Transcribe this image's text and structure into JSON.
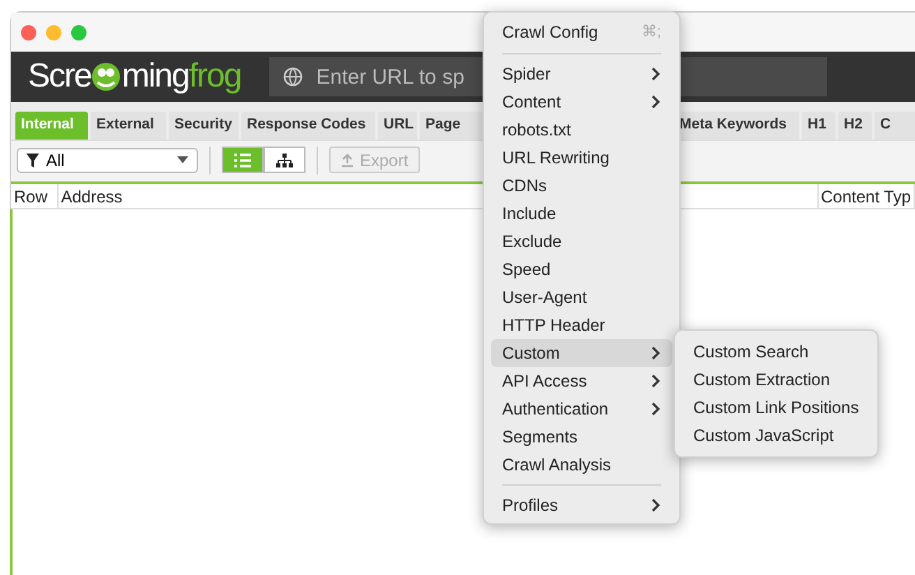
{
  "logo": {
    "prefix": "Scre",
    "middle": "ming",
    "suffix": "frog"
  },
  "url_field": {
    "placeholder": "Enter URL to sp"
  },
  "tabs": [
    {
      "label": "Internal",
      "selected": true
    },
    {
      "label": "External",
      "selected": false
    },
    {
      "label": "Security",
      "selected": false
    },
    {
      "label": "Response Codes",
      "selected": false
    },
    {
      "label": "URL",
      "selected": false
    },
    {
      "label": "Page",
      "selected": false
    },
    {
      "label": "Meta Keywords",
      "selected": false
    },
    {
      "label": "H1",
      "selected": false
    },
    {
      "label": "H2",
      "selected": false
    },
    {
      "label": "C",
      "selected": false
    }
  ],
  "filter": {
    "value": "All"
  },
  "view_toggle": [
    {
      "kind": "list",
      "selected": true
    },
    {
      "kind": "tree",
      "selected": false
    }
  ],
  "export_button": {
    "label": "Export",
    "disabled": true
  },
  "table": {
    "columns": [
      "Row",
      "Address",
      "Content Typ"
    ]
  },
  "menu": {
    "items": [
      {
        "kind": "header",
        "label": "Crawl Config",
        "shortcut": "⌘;"
      },
      {
        "kind": "separator"
      },
      {
        "kind": "item",
        "label": "Spider",
        "submenu": true,
        "selected": false
      },
      {
        "kind": "item",
        "label": "Content",
        "submenu": true,
        "selected": false
      },
      {
        "kind": "item",
        "label": "robots.txt",
        "submenu": false,
        "selected": false
      },
      {
        "kind": "item",
        "label": "URL Rewriting",
        "submenu": false,
        "selected": false
      },
      {
        "kind": "item",
        "label": "CDNs",
        "submenu": false,
        "selected": false
      },
      {
        "kind": "item",
        "label": "Include",
        "submenu": false,
        "selected": false
      },
      {
        "kind": "item",
        "label": "Exclude",
        "submenu": false,
        "selected": false
      },
      {
        "kind": "item",
        "label": "Speed",
        "submenu": false,
        "selected": false
      },
      {
        "kind": "item",
        "label": "User-Agent",
        "submenu": false,
        "selected": false
      },
      {
        "kind": "item",
        "label": "HTTP Header",
        "submenu": false,
        "selected": false
      },
      {
        "kind": "item",
        "label": "Custom",
        "submenu": true,
        "selected": true
      },
      {
        "kind": "item",
        "label": "API Access",
        "submenu": true,
        "selected": false
      },
      {
        "kind": "item",
        "label": "Authentication",
        "submenu": true,
        "selected": false
      },
      {
        "kind": "item",
        "label": "Segments",
        "submenu": false,
        "selected": false
      },
      {
        "kind": "item",
        "label": "Crawl Analysis",
        "submenu": false,
        "selected": false
      },
      {
        "kind": "separator"
      },
      {
        "kind": "item",
        "label": "Profiles",
        "submenu": true,
        "selected": false
      }
    ]
  },
  "submenu": {
    "items": [
      "Custom Search",
      "Custom Extraction",
      "Custom Link Positions",
      "Custom JavaScript"
    ]
  }
}
